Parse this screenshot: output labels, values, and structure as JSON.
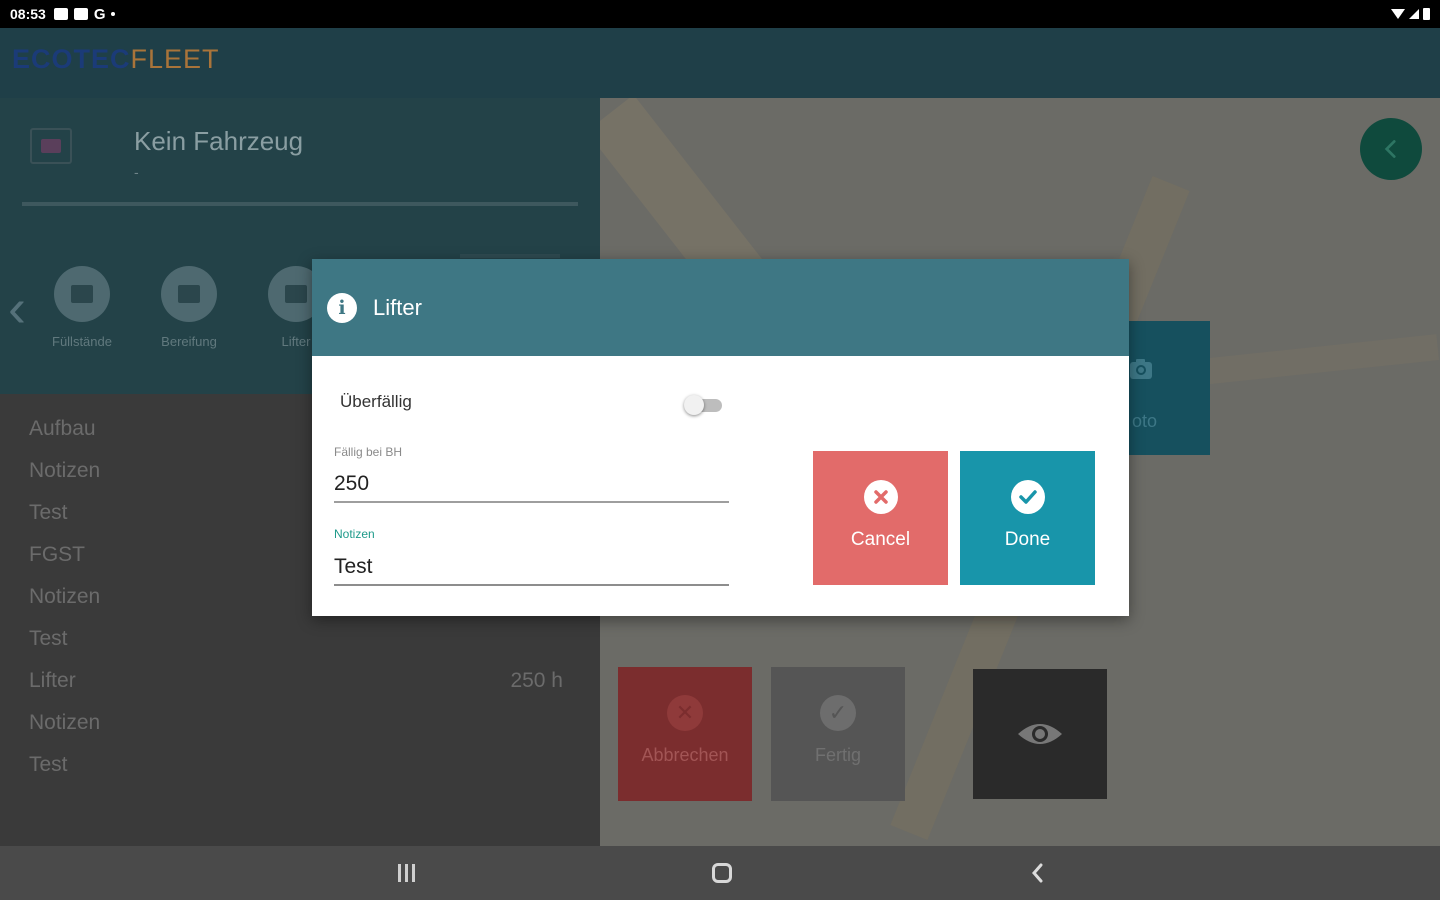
{
  "status_bar": {
    "time": "08:53",
    "g_label": "G"
  },
  "app": {
    "logo_primary": "ECOTEC",
    "logo_secondary": "FLEET"
  },
  "vehicle": {
    "title": "Kein Fahrzeug",
    "subtitle": "-"
  },
  "categories": [
    {
      "label": "Füllstände",
      "icon": "category-icon"
    },
    {
      "label": "Bereifung",
      "icon": "category-icon"
    },
    {
      "label": "Lifter",
      "icon": "category-icon"
    }
  ],
  "list": [
    {
      "label": "Aufbau",
      "value": ""
    },
    {
      "label": "Notizen",
      "value": ""
    },
    {
      "label": "Test",
      "value": ""
    },
    {
      "label": "FGST",
      "value": ""
    },
    {
      "label": "Notizen",
      "value": ""
    },
    {
      "label": "Test",
      "value": ""
    },
    {
      "label": "Lifter",
      "value": "250 h"
    },
    {
      "label": "Notizen",
      "value": ""
    },
    {
      "label": "Test",
      "value": ""
    }
  ],
  "background_actions": {
    "photo_label": "oto",
    "cancel_label": "Abbrechen",
    "done_label": "Fertig"
  },
  "dialog": {
    "title": "Lifter",
    "overdue_label": "Überfällig",
    "overdue_on": false,
    "due_label": "Fällig bei BH",
    "due_value": "250",
    "notes_label": "Notizen",
    "notes_value": "Test",
    "cancel_label": "Cancel",
    "done_label": "Done"
  },
  "colors": {
    "dialog_header": "#3e7784",
    "cancel_button": "#e26b6a",
    "done_button": "#1895aa",
    "accent_teal": "#1e9a8a"
  }
}
